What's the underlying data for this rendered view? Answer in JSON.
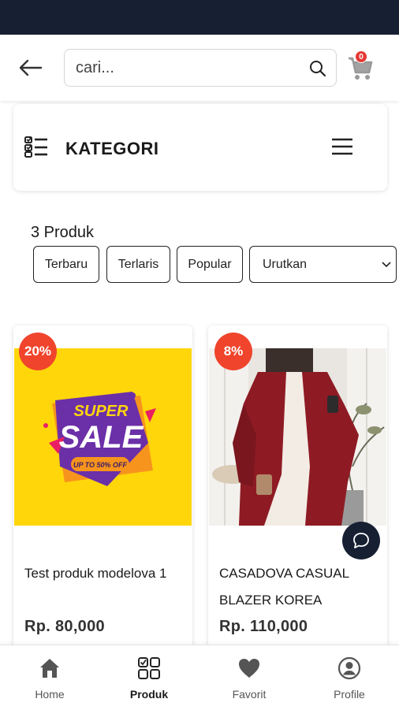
{
  "header": {
    "search_placeholder": "cari...",
    "cart_count": "0"
  },
  "category": {
    "title": "KATEGORI"
  },
  "products_count": "3 Produk",
  "filters": [
    "Terbaru",
    "Terlaris",
    "Popular"
  ],
  "sort": {
    "selected": "Urutkan"
  },
  "products": [
    {
      "discount": "20%",
      "name": "Test produk modelova 1",
      "price": "Rp. 80,000",
      "image_text": {
        "line1": "SUPER",
        "line2": "SALE",
        "line3": "UP TO 50% OFF"
      }
    },
    {
      "discount": "8%",
      "name": "CASADOVA CASUAL BLAZER KOREA",
      "price": "Rp. 110,000"
    }
  ],
  "nav": {
    "items": [
      {
        "label": "Home",
        "icon": "home-icon"
      },
      {
        "label": "Produk",
        "icon": "grid-icon"
      },
      {
        "label": "Favorit",
        "icon": "heart-icon"
      },
      {
        "label": "Profile",
        "icon": "user-icon"
      }
    ],
    "active": "Produk"
  },
  "colors": {
    "statusbar": "#172033",
    "accent_dark": "#172033",
    "discount": "#f0442c",
    "sale_bg": "#ffd60a",
    "blazer": "#8e1b24"
  }
}
